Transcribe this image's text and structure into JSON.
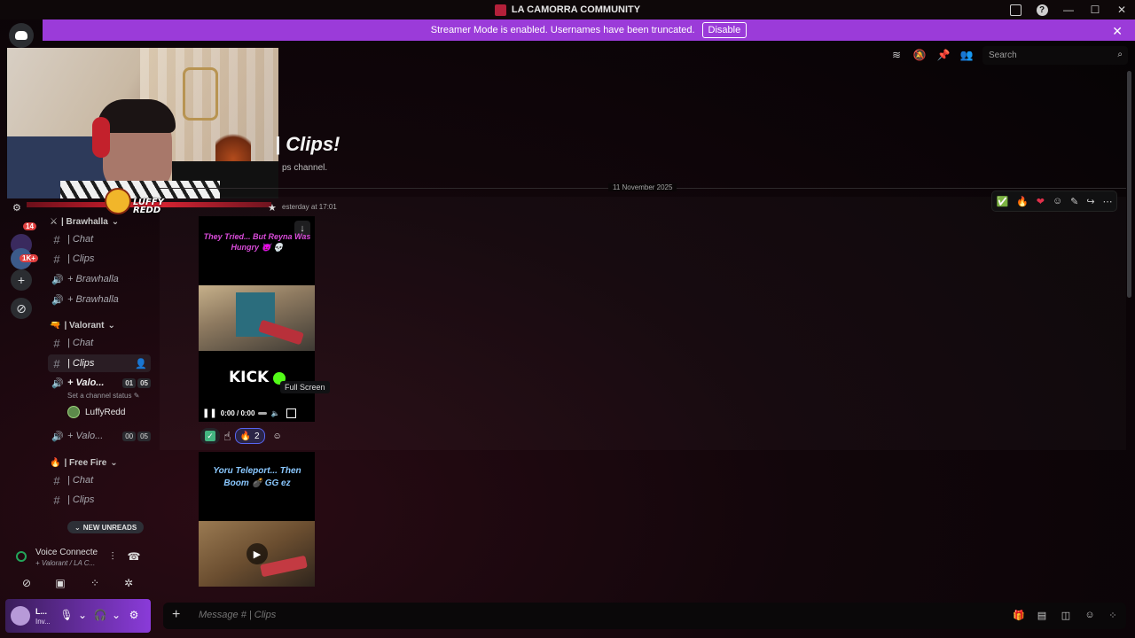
{
  "window": {
    "title": "LA CAMORRA COMMUNITY",
    "controls": [
      "—",
      "☐",
      "✕"
    ]
  },
  "banner": {
    "text": "Streamer Mode is enabled. Usernames have been truncated.",
    "disable_label": "Disable",
    "close": "✕"
  },
  "rail": {
    "badges": [
      "14",
      "1K+"
    ],
    "add_server": "+",
    "discover": "⊘"
  },
  "webcam": {
    "overlay_text": "LUFFY\nREDD"
  },
  "header": {
    "search_placeholder": "Search",
    "icons": [
      "threads-icon",
      "mute-icon",
      "pin-icon",
      "members-icon"
    ]
  },
  "channels": {
    "categories": [
      {
        "label": "| Brawhalla",
        "emoji": "⚔"
      },
      {
        "label": "| Valorant",
        "emoji": "🔫"
      },
      {
        "label": "| Free Fire",
        "emoji": "🔥"
      }
    ],
    "items": [
      {
        "label": "| Chat"
      },
      {
        "label": "| Clips"
      },
      {
        "label": "+ Brawhalla"
      },
      {
        "label": "+ Brawhalla"
      },
      {
        "label": "| Chat"
      },
      {
        "label": "| Clips"
      },
      {
        "label": "+ Valo...",
        "count_a": "01",
        "count_b": "05"
      },
      {
        "label": "+ Valo...",
        "count_a": "00",
        "count_b": "05"
      },
      {
        "label": "| Chat"
      },
      {
        "label": "| Clips"
      }
    ],
    "channel_status": "Set a channel status",
    "voice_user": "LuffyRedd",
    "new_unreads": "NEW UNREADS"
  },
  "voice_panel": {
    "title": "Voice Connecte",
    "subtitle": "+ Valorant / LA C..."
  },
  "user_panel": {
    "name": "L...",
    "status": "Inv..."
  },
  "main": {
    "welcome_title": "| Clips!",
    "welcome_sub": "ps channel.",
    "date_divider": "11 November 2025",
    "timestamp": "esterday at 17:01",
    "video1": {
      "caption": "They Tried... But Reyna Was Hungry 👿 💀",
      "brand": "KICK",
      "time": "0:00 / 0:00",
      "download": "↓"
    },
    "tooltip": "Full Screen",
    "reactions": [
      {
        "emoji": "✓",
        "count": ""
      },
      {
        "emoji": "🔥",
        "count": "2"
      }
    ],
    "video2": {
      "caption": "Yoru Teleport... Then Boom 💣 GG ez",
      "play": "▶"
    }
  },
  "composer": {
    "placeholder": "Message # | Clips"
  }
}
